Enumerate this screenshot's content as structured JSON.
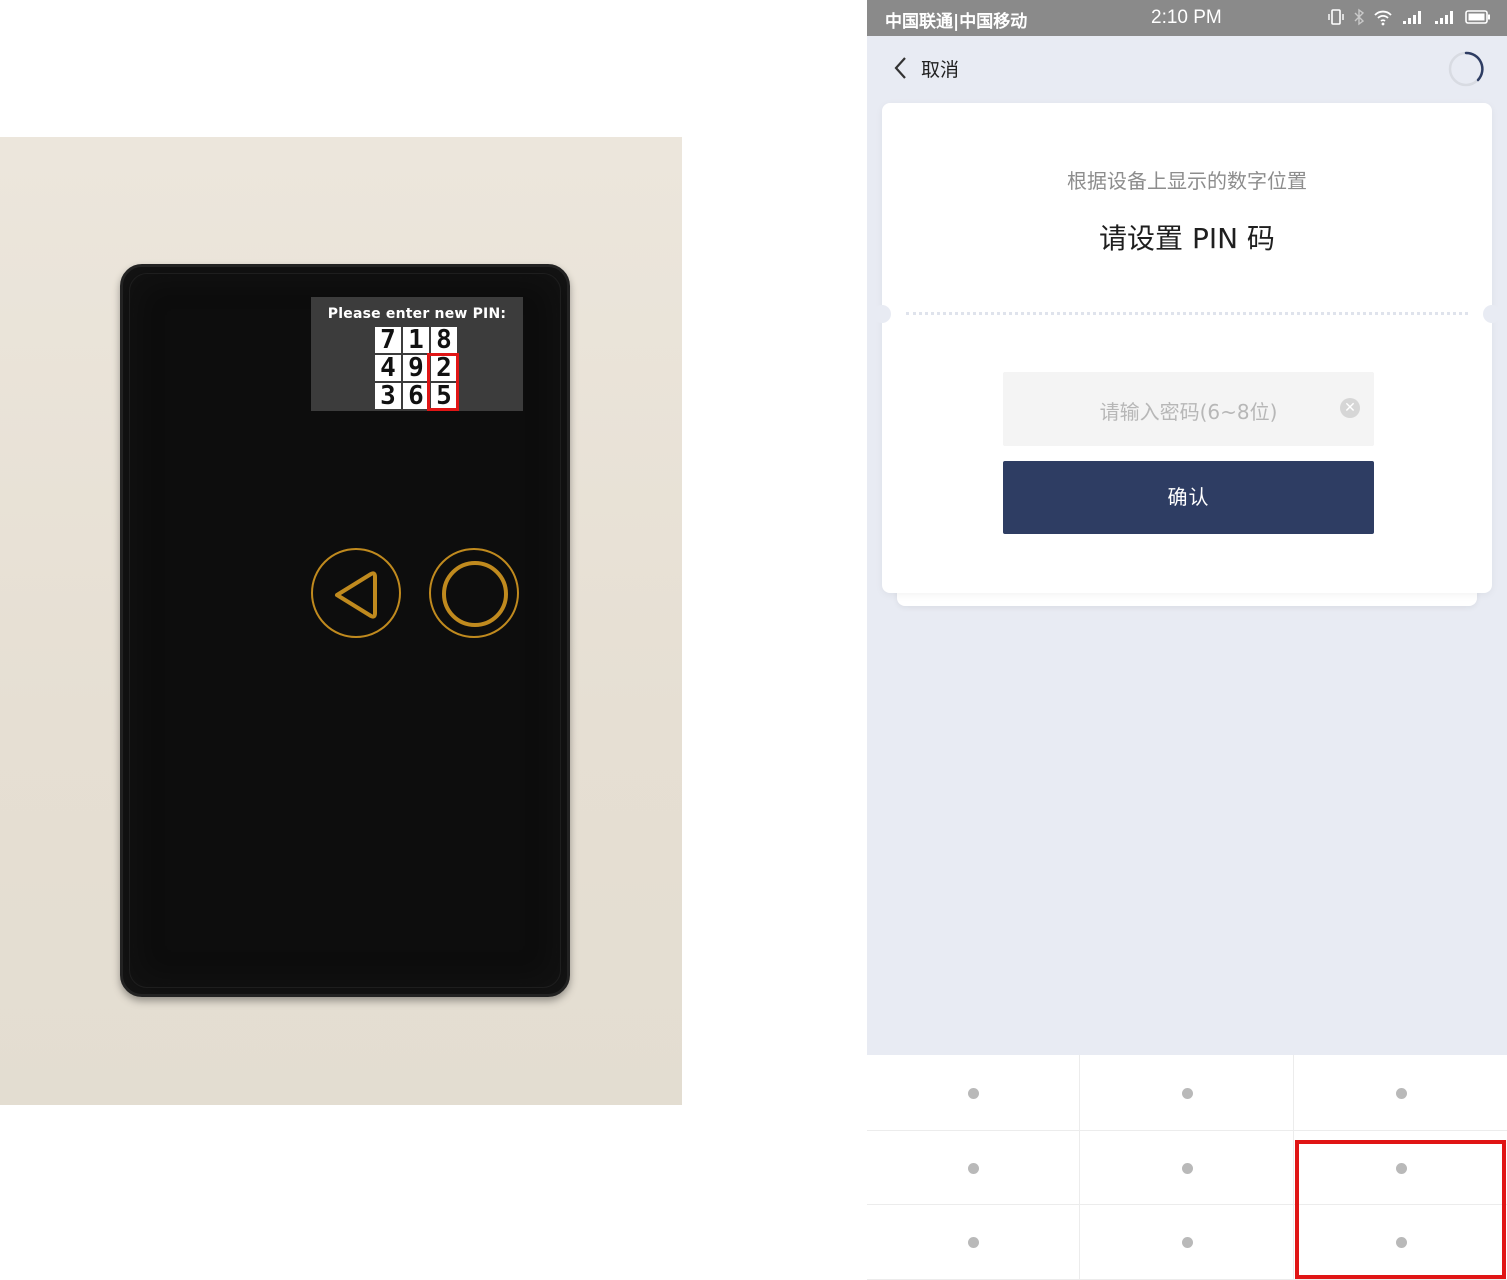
{
  "device_photo": {
    "screen_prompt": "Please enter new PIN:",
    "pin_layout": [
      [
        "7",
        "1",
        "8"
      ],
      [
        "4",
        "9",
        "2"
      ],
      [
        "3",
        "6",
        "5"
      ]
    ],
    "button_color": "#c08a1e",
    "highlight_color": "#e01515"
  },
  "status_bar": {
    "carrier": "中国联通|中国移动",
    "time": "2:10 PM",
    "icons": [
      "vibrate-icon",
      "bluetooth-icon",
      "wifi-icon",
      "signal-icon",
      "signal-icon",
      "battery-icon"
    ]
  },
  "nav": {
    "back_label": "取消"
  },
  "sheet": {
    "subtitle": "根据设备上显示的数字位置",
    "title": "请设置 PIN 码",
    "password_placeholder": "请输入密码(6~8位)",
    "confirm_label": "确认"
  },
  "keypad": {
    "keys": 9,
    "dot_color": "#b9b9b9"
  },
  "colors": {
    "background": "#e8ebf3",
    "primary": "#2e3d63",
    "status_bar": "#8a8a8a"
  }
}
